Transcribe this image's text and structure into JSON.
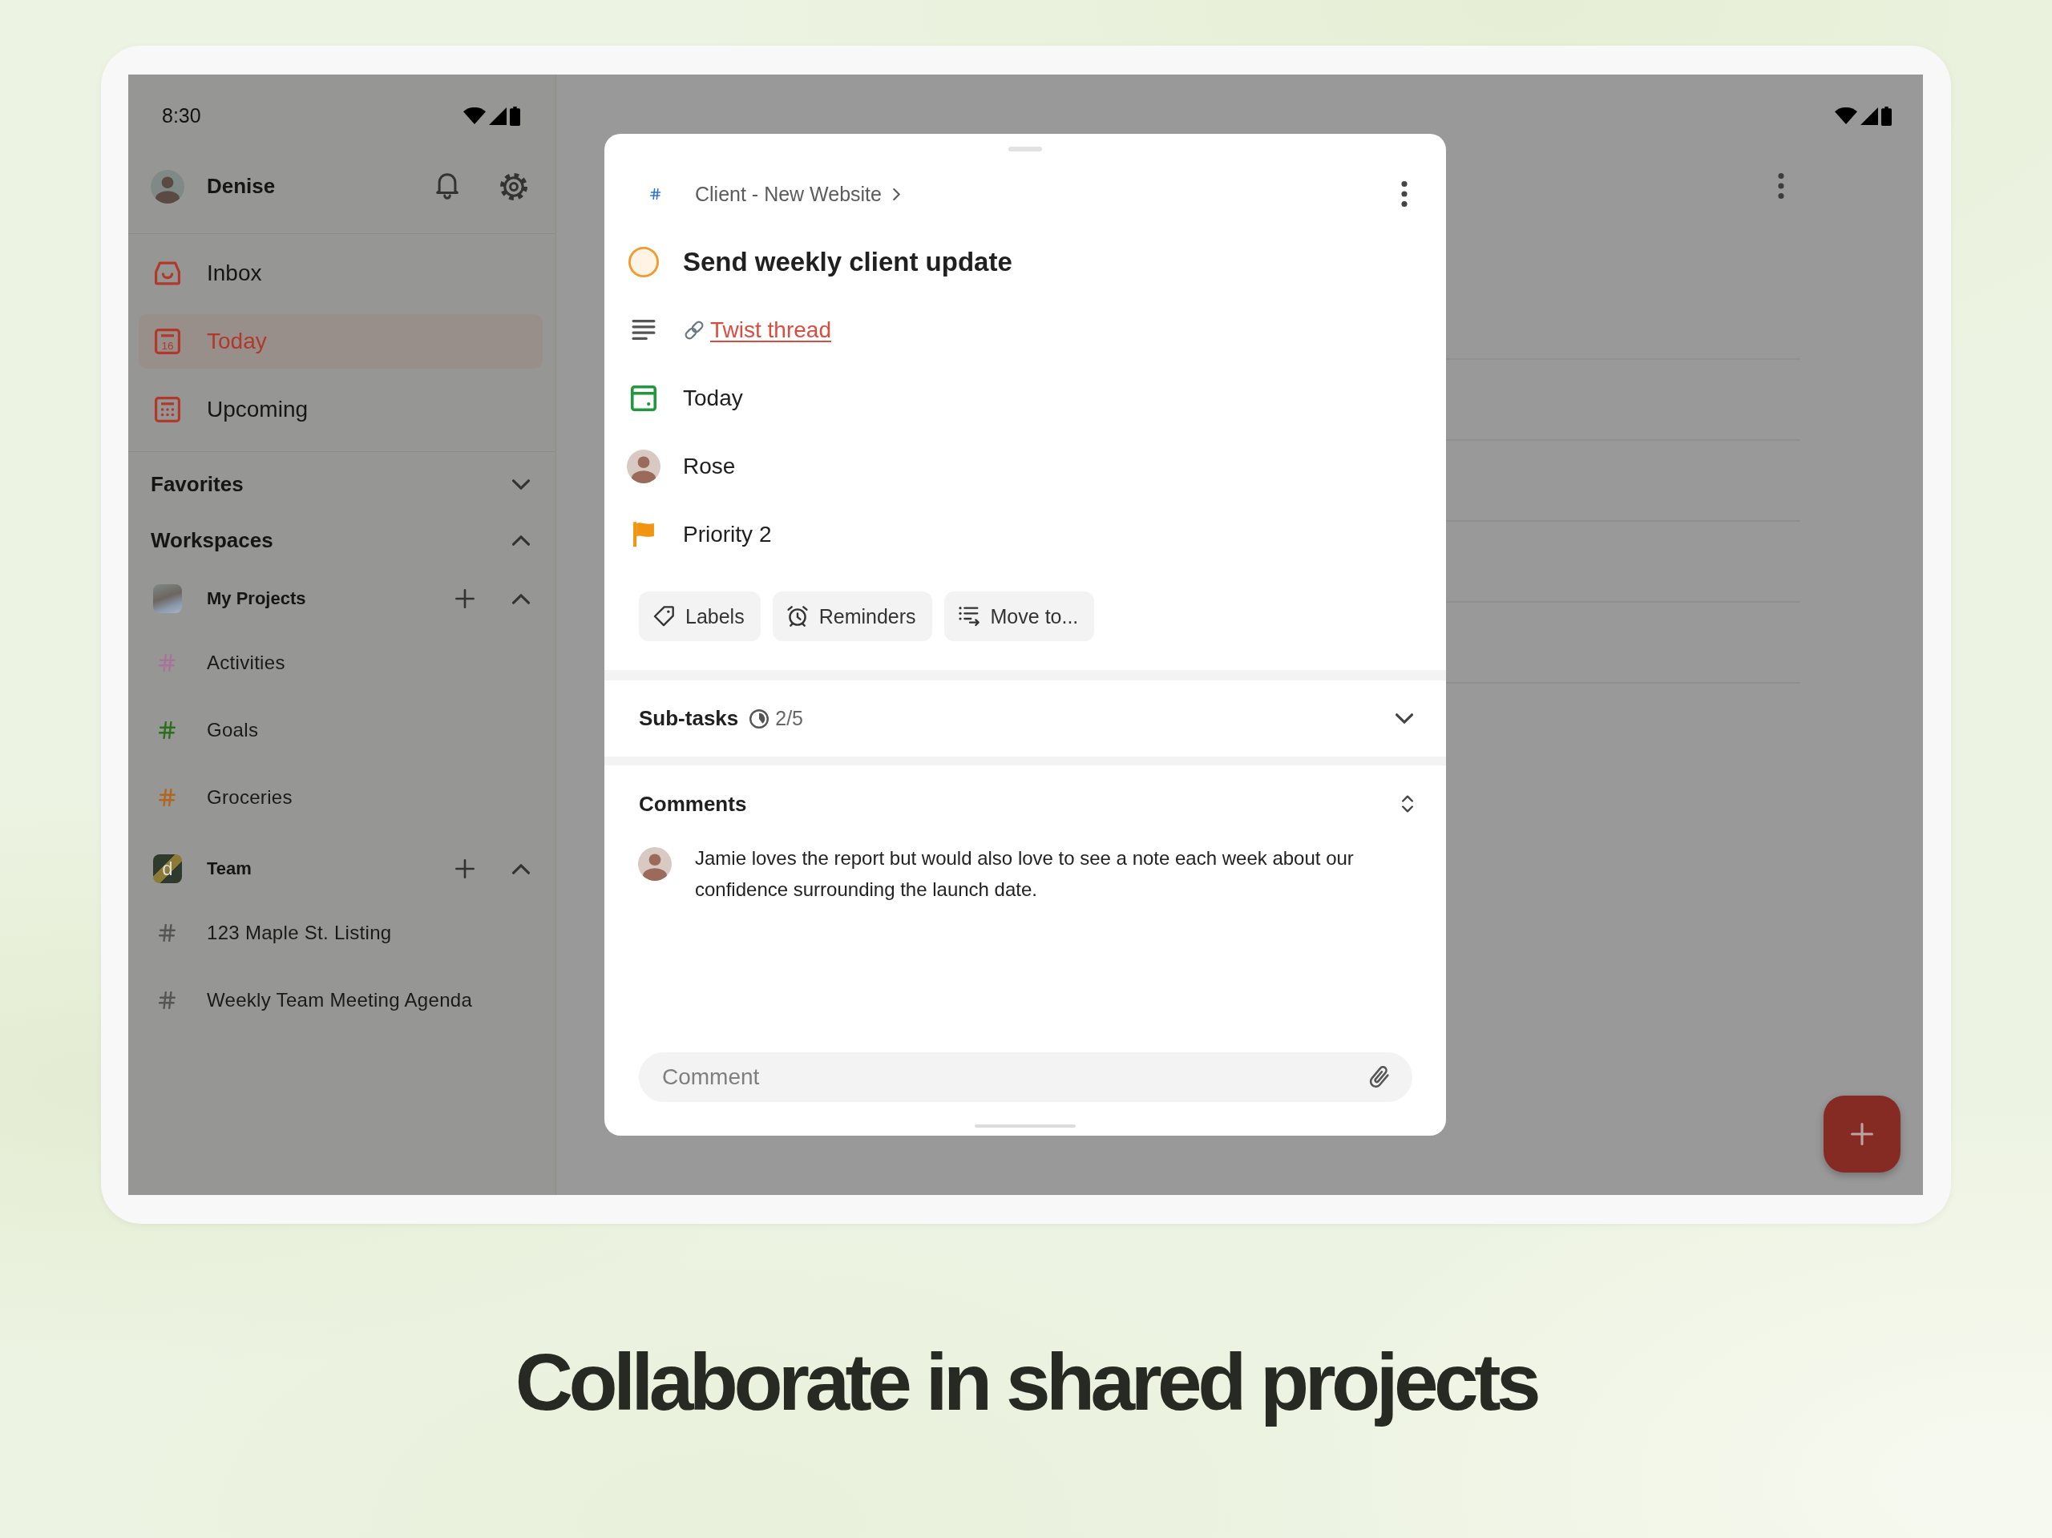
{
  "status_bar": {
    "time": "8:30"
  },
  "sidebar": {
    "user": {
      "name": "Denise"
    },
    "nav_items": [
      {
        "label": "Inbox",
        "kind": "inbox",
        "selected": false
      },
      {
        "label": "Today",
        "kind": "today",
        "icon_text": "16",
        "selected": true
      },
      {
        "label": "Upcoming",
        "kind": "upcoming",
        "selected": false
      }
    ],
    "favorites": {
      "title": "Favorites",
      "expanded": false
    },
    "workspaces": {
      "title": "Workspaces",
      "expanded": true,
      "items": [
        {
          "name": "My Projects",
          "kind": "photo",
          "expanded": true,
          "projects": [
            {
              "name": "Activities",
              "color": "#a8739a"
            },
            {
              "name": "Goals",
              "color": "#2b6e1c"
            },
            {
              "name": "Groceries",
              "color": "#b0661c"
            }
          ]
        },
        {
          "name": "Team",
          "kind": "logo",
          "logo_letter": "d",
          "expanded": true,
          "projects": [
            {
              "name": "123 Maple St. Listing",
              "color": "#555555"
            },
            {
              "name": "Weekly Team Meeting Agenda",
              "color": "#555555"
            }
          ]
        }
      ]
    }
  },
  "task": {
    "project": "Client - New Website",
    "title": "Send weekly client update",
    "completed": false,
    "description_link": "Twist thread",
    "details": [
      {
        "kind": "date",
        "text": "Today"
      },
      {
        "kind": "assignee",
        "text": "Rose"
      },
      {
        "kind": "priority",
        "text": "Priority 2"
      }
    ],
    "actions": [
      {
        "kind": "labels",
        "label": "Labels"
      },
      {
        "kind": "reminders",
        "label": "Reminders"
      },
      {
        "kind": "move",
        "label": "Move to..."
      }
    ],
    "subtasks": {
      "title": "Sub-tasks",
      "count": "2/5",
      "expanded": false
    },
    "comments": {
      "title": "Comments",
      "items": [
        {
          "text": "Jamie loves the report but would also love to see a note each week about our confidence surrounding the launch date."
        }
      ],
      "input": {
        "placeholder": "Comment"
      }
    }
  },
  "caption": "Collaborate in shared projects"
}
